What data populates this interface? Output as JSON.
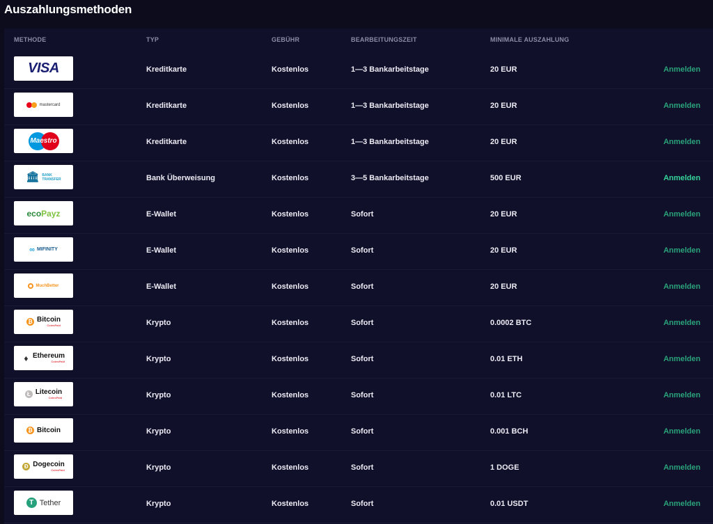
{
  "title": "Auszahlungsmethoden",
  "headers": {
    "methode": "METHODE",
    "typ": "TYP",
    "gebuehr": "GEBÜHR",
    "zeit": "BEARBEITUNGSZEIT",
    "min": "MINIMALE AUSZAHLUNG"
  },
  "logos": {
    "visa": "VISA",
    "mastercard": "mastercard",
    "maestro": "Maestro",
    "bank_line1": "BANK",
    "bank_line2": "TRANSFER",
    "ecopayz_a": "eco",
    "ecopayz_b": "Payz",
    "mifinity": "MIFINITY",
    "muchbetter": "MuchBetter",
    "bitcoin": "Bitcoin",
    "ethereum": "Ethereum",
    "litecoin": "Litecoin",
    "dogecoin": "Dogecoin",
    "tether": "Tether",
    "coinspaid": "CoinsPaid"
  },
  "rows": [
    {
      "typ": "Kreditkarte",
      "gebuehr": "Kostenlos",
      "zeit": "1—3 Bankarbeitstage",
      "min": "20 EUR",
      "action": "Anmelden"
    },
    {
      "typ": "Kreditkarte",
      "gebuehr": "Kostenlos",
      "zeit": "1—3 Bankarbeitstage",
      "min": "20 EUR",
      "action": "Anmelden"
    },
    {
      "typ": "Kreditkarte",
      "gebuehr": "Kostenlos",
      "zeit": "1—3 Bankarbeitstage",
      "min": "20 EUR",
      "action": "Anmelden"
    },
    {
      "typ": "Bank Überweisung",
      "gebuehr": "Kostenlos",
      "zeit": "3—5 Bankarbeitstage",
      "min": "500 EUR",
      "action": "Anmelden"
    },
    {
      "typ": "E-Wallet",
      "gebuehr": "Kostenlos",
      "zeit": "Sofort",
      "min": "20 EUR",
      "action": "Anmelden"
    },
    {
      "typ": "E-Wallet",
      "gebuehr": "Kostenlos",
      "zeit": "Sofort",
      "min": "20 EUR",
      "action": "Anmelden"
    },
    {
      "typ": "E-Wallet",
      "gebuehr": "Kostenlos",
      "zeit": "Sofort",
      "min": "20 EUR",
      "action": "Anmelden"
    },
    {
      "typ": "Krypto",
      "gebuehr": "Kostenlos",
      "zeit": "Sofort",
      "min": "0.0002 BTC",
      "action": "Anmelden"
    },
    {
      "typ": "Krypto",
      "gebuehr": "Kostenlos",
      "zeit": "Sofort",
      "min": "0.01 ETH",
      "action": "Anmelden"
    },
    {
      "typ": "Krypto",
      "gebuehr": "Kostenlos",
      "zeit": "Sofort",
      "min": "0.01 LTC",
      "action": "Anmelden"
    },
    {
      "typ": "Krypto",
      "gebuehr": "Kostenlos",
      "zeit": "Sofort",
      "min": "0.001 BCH",
      "action": "Anmelden"
    },
    {
      "typ": "Krypto",
      "gebuehr": "Kostenlos",
      "zeit": "Sofort",
      "min": "1 DOGE",
      "action": "Anmelden"
    },
    {
      "typ": "Krypto",
      "gebuehr": "Kostenlos",
      "zeit": "Sofort",
      "min": "0.01 USDT",
      "action": "Anmelden"
    }
  ],
  "colors": {
    "background": "#0c0c1d",
    "table": "#10102a",
    "action": "#2aa27a",
    "action_highlight": "#35d49a"
  }
}
